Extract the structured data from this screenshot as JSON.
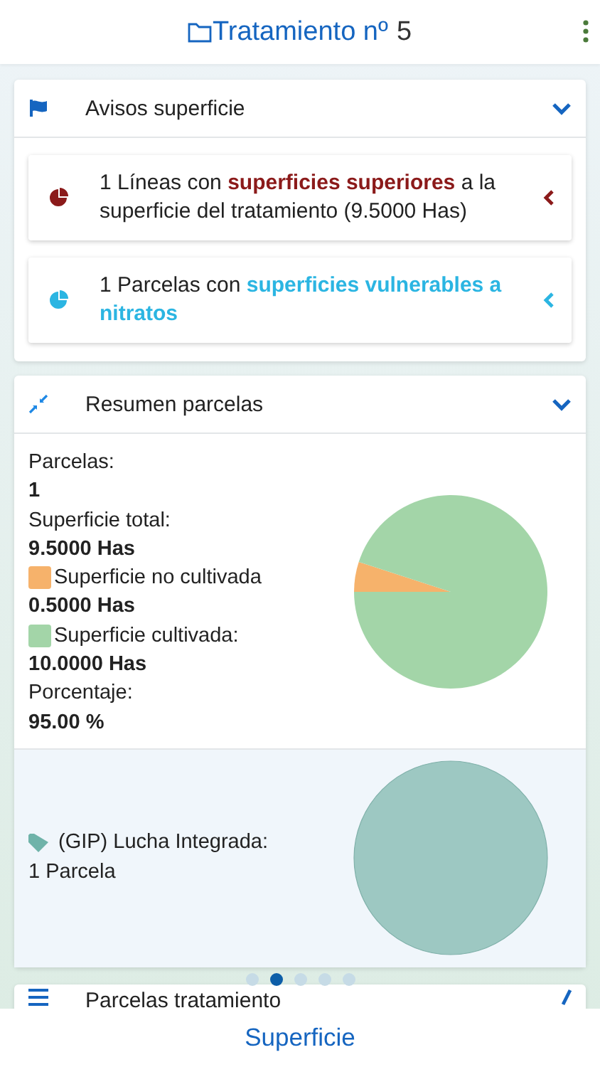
{
  "header": {
    "title": "Tratamiento nº",
    "number": "5"
  },
  "sections": [
    {
      "kind": "alerts",
      "title": "Avisos superficie",
      "expanded": true,
      "alerts": [
        {
          "text": "1 Líneas con **superficies superiores** a la superficie del tratamiento (9.5000 Has)",
          "color": "#8b1a1a"
        },
        {
          "text": "1 Parcelas con **superficies vulnerables a nitratos**",
          "color": "#2bb5e2"
        }
      ]
    },
    {
      "kind": "summary",
      "title": "Resumen parcelas",
      "expanded": true,
      "fields": [
        {
          "kind": "label",
          "text": "Parcelas:"
        },
        {
          "kind": "value",
          "text": "1"
        },
        {
          "kind": "label",
          "text": "Superficie total:"
        },
        {
          "kind": "value",
          "text": "9.5000 Has"
        },
        {
          "kind": "legend",
          "text": "Superficie no cultivada",
          "color": "#f6b26b"
        },
        {
          "kind": "value",
          "text": "0.5000 Has"
        },
        {
          "kind": "legend",
          "text": "Superficie cultivada:",
          "color": "#a3d5a8"
        },
        {
          "kind": "value",
          "text": "10.0000 Has"
        },
        {
          "kind": "label",
          "text": "Porcentaje:"
        },
        {
          "kind": "value",
          "text": "95.00 %"
        }
      ],
      "chart_data": {
        "type": "pie",
        "values": [
          5,
          95
        ],
        "colors": [
          "#f6b26b",
          "#a3d5a8"
        ]
      },
      "groups": [
        {
          "label": "(GIP) Lucha Integrada:",
          "count": "1 Parcela"
        }
      ]
    },
    {
      "kind": "list",
      "title": "Parcelas tratamiento"
    }
  ],
  "pager": [
    {
      "selected": false
    },
    {
      "selected": true
    },
    {
      "selected": false
    },
    {
      "selected": false
    },
    {
      "selected": false
    }
  ],
  "bottom_bar": {
    "label": "Superficie"
  }
}
